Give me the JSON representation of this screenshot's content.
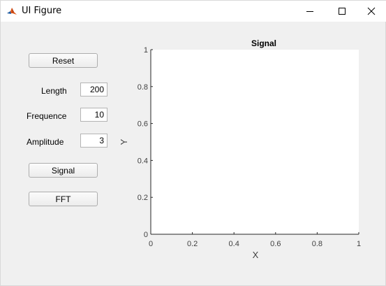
{
  "window": {
    "title": "UI Figure",
    "icon": "matlab-logo-icon",
    "controls": {
      "minimize_icon": "minimize-icon",
      "maximize_icon": "maximize-icon",
      "close_icon": "close-icon"
    }
  },
  "controls": {
    "reset_label": "Reset",
    "length_label": "Length",
    "length_value": "200",
    "frequence_label": "Frequence",
    "frequence_value": "10",
    "amplitude_label": "Amplitude",
    "amplitude_value": "3",
    "signal_label": "Signal",
    "fft_label": "FFT"
  },
  "chart_data": {
    "type": "line",
    "title": "Signal",
    "xlabel": "X",
    "ylabel": "Y",
    "xlim": [
      0,
      1
    ],
    "ylim": [
      0,
      1
    ],
    "xticks": [
      "0",
      "0.2",
      "0.4",
      "0.6",
      "0.8",
      "1"
    ],
    "yticks": [
      "0",
      "0.2",
      "0.4",
      "0.6",
      "0.8",
      "1"
    ],
    "series": [],
    "grid": false,
    "colors": {
      "axis": "#262626",
      "tick_label": "#404040",
      "plot_bg": "#ffffff"
    }
  }
}
